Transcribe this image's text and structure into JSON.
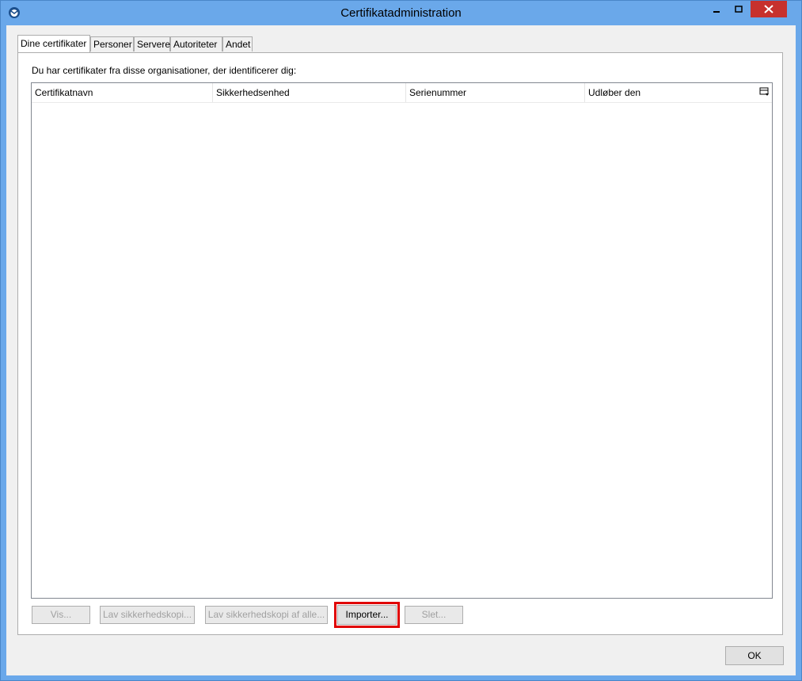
{
  "window": {
    "title": "Certifikatadministration"
  },
  "tabs": [
    {
      "label": "Dine certifikater",
      "active": true
    },
    {
      "label": "Personer"
    },
    {
      "label": "Servere"
    },
    {
      "label": "Autoriteter"
    },
    {
      "label": "Andet"
    }
  ],
  "panel": {
    "description": "Du har certifikater fra disse organisationer, der identificerer dig:",
    "columns": [
      "Certifikatnavn",
      "Sikkerhedsenhed",
      "Serienummer",
      "Udløber den"
    ]
  },
  "buttons": {
    "view": "Vis...",
    "backup": "Lav sikkerhedskopi...",
    "backup_all": "Lav sikkerhedskopi af alle...",
    "import": "Importer...",
    "delete": "Slet..."
  },
  "ok": "OK",
  "colors": {
    "titlebar": "#6aa8ea",
    "close": "#c7312d",
    "highlight": "#e00000"
  }
}
